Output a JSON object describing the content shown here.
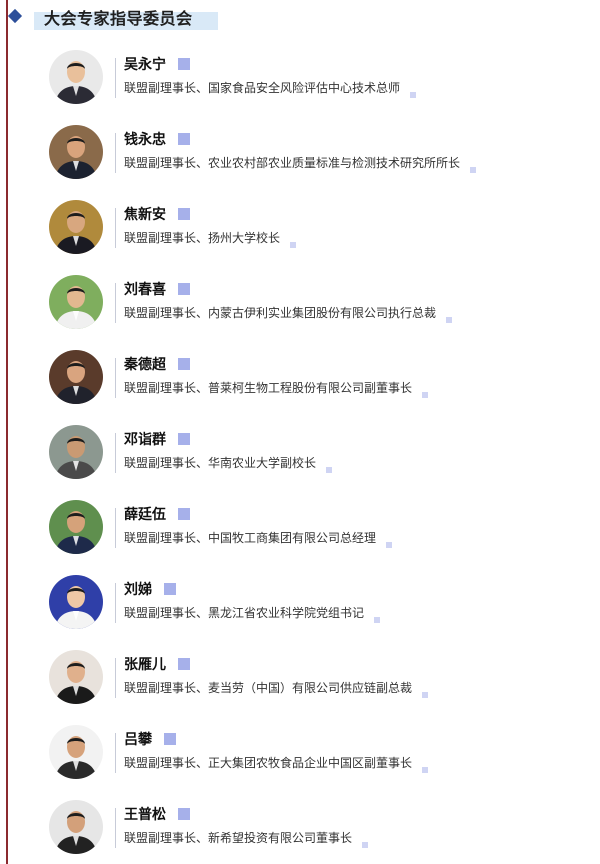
{
  "section_title": "大会专家指导委员会",
  "members": [
    {
      "name": "吴永宁",
      "role": "联盟副理事长、国家食品安全风险评估中心技术总师"
    },
    {
      "name": "钱永忠",
      "role": "联盟副理事长、农业农村部农业质量标准与检测技术研究所所长"
    },
    {
      "name": "焦新安",
      "role": "联盟副理事长、扬州大学校长"
    },
    {
      "name": "刘春喜",
      "role": "联盟副理事长、内蒙古伊利实业集团股份有限公司执行总裁"
    },
    {
      "name": "秦德超",
      "role": "联盟副理事长、普莱柯生物工程股份有限公司副董事长"
    },
    {
      "name": "邓诣群",
      "role": "联盟副理事长、华南农业大学副校长"
    },
    {
      "name": "薛廷伍",
      "role": "联盟副理事长、中国牧工商集团有限公司总经理"
    },
    {
      "name": "刘娣",
      "role": "联盟副理事长、黑龙江省农业科学院党组书记"
    },
    {
      "name": "张雁儿",
      "role": "联盟副理事长、麦当劳（中国）有限公司供应链副总裁"
    },
    {
      "name": "吕攀",
      "role": "联盟副理事长、正大集团农牧食品企业中国区副董事长"
    },
    {
      "name": "王普松",
      "role": "联盟副理事长、新希望投资有限公司董事长"
    }
  ],
  "colors": {
    "accent_line": "#8b2a2f",
    "diamond": "#2d4f9a",
    "title_highlight": "#d9e9f7",
    "name_marker": "#a6b0ea",
    "role_marker": "#cfd4f3"
  },
  "icons": {
    "bullet": "diamond-bullet-icon",
    "avatar": "portrait-photo"
  }
}
